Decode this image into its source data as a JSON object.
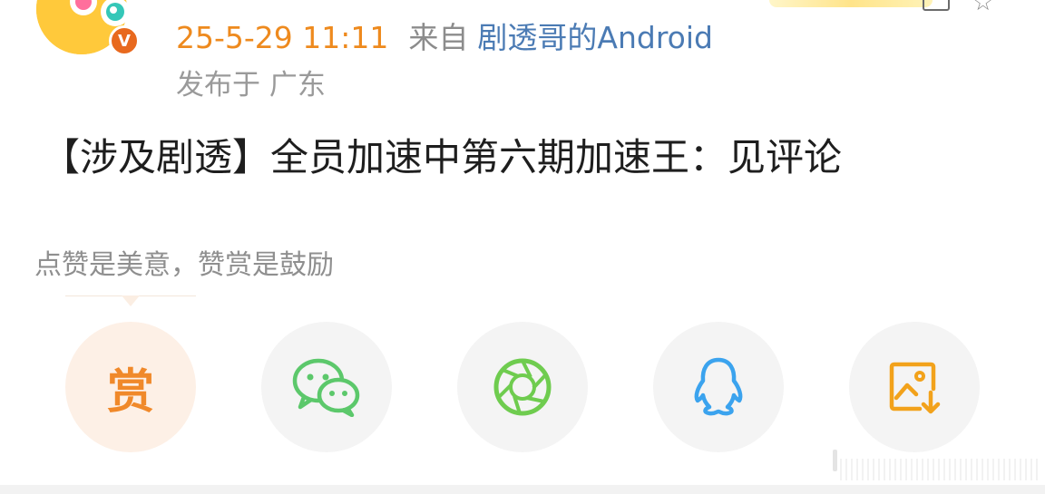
{
  "post": {
    "time": "25-5-29 11:11",
    "from_label": "来自",
    "source": "剧透哥的Android",
    "location": "发布于 广东",
    "text": "【涉及剧透】全员加速中第六期加速王：见评论"
  },
  "avatar": {
    "badge": "V"
  },
  "reward_tip": "点赞是美意，赞赏是鼓励",
  "share": {
    "reward_label": "赏",
    "items": [
      {
        "name": "reward",
        "icon": "reward-icon",
        "color": "#f0892a"
      },
      {
        "name": "wechat",
        "icon": "wechat-icon",
        "color": "#5cc86b"
      },
      {
        "name": "moments",
        "icon": "moments-aperture-icon",
        "color": "#6fcc4f"
      },
      {
        "name": "qq",
        "icon": "qq-penguin-icon",
        "color": "#3ba3ee"
      },
      {
        "name": "save-image",
        "icon": "save-image-icon",
        "color": "#f2a21b"
      }
    ]
  },
  "colors": {
    "time": "#ee8a1e",
    "source": "#4b7bb4",
    "muted": "#8c8c8c",
    "text": "#1e1e1e"
  }
}
